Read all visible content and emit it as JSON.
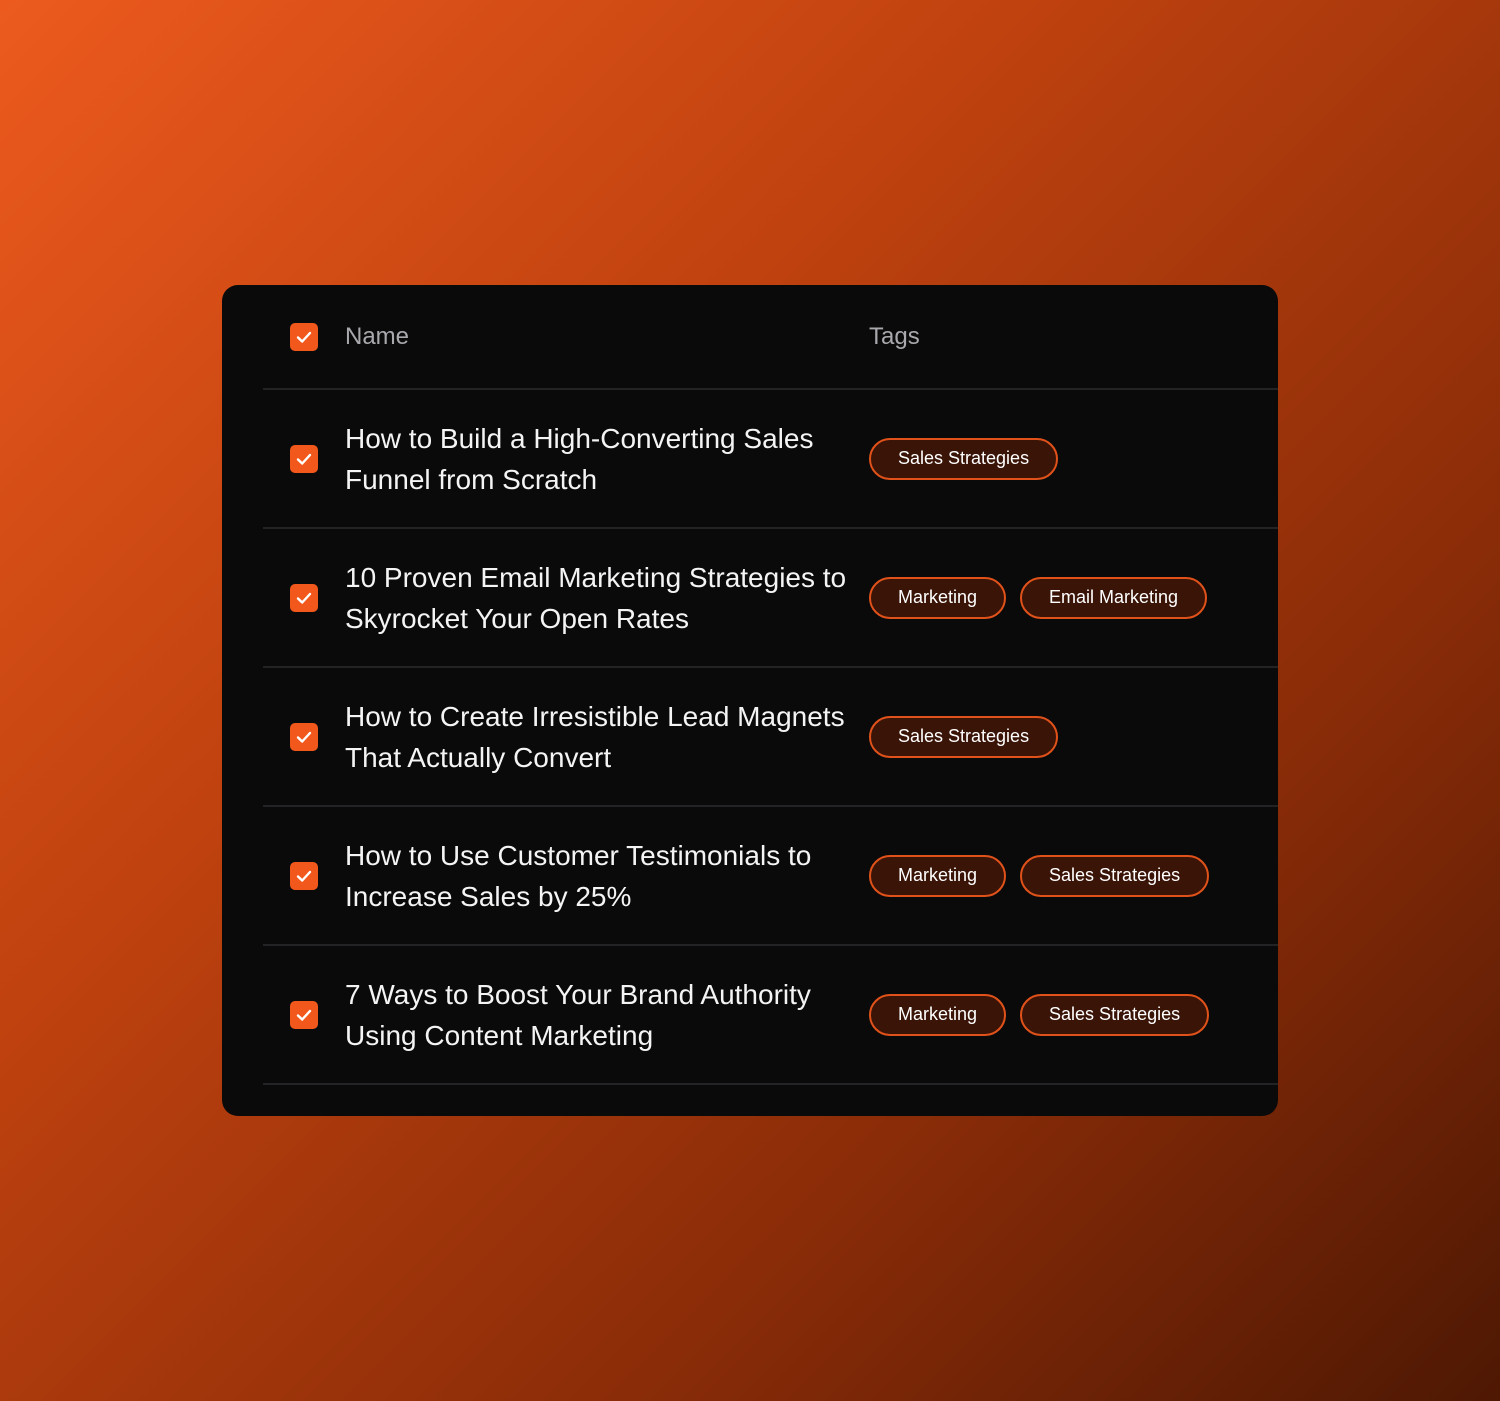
{
  "colors": {
    "accent": "#f2581b",
    "panel_bg": "#0a0a0b",
    "tag_bg": "#3a1407",
    "tag_border": "#e0521a"
  },
  "table": {
    "columns": {
      "name": "Name",
      "tags": "Tags"
    },
    "header_checked": true,
    "rows": [
      {
        "checked": true,
        "title": "How to Build a High-Converting Sales Funnel from Scratch",
        "tags": [
          "Sales Strategies"
        ]
      },
      {
        "checked": true,
        "title": "10 Proven Email Marketing Strategies to Skyrocket Your Open Rates",
        "tags": [
          "Marketing",
          "Email Marketing"
        ]
      },
      {
        "checked": true,
        "title": "How to Create Irresistible Lead Magnets That Actually Convert",
        "tags": [
          "Sales Strategies"
        ]
      },
      {
        "checked": true,
        "title": "How to Use Customer Testimonials to Increase Sales by 25%",
        "tags": [
          "Marketing",
          "Sales Strategies"
        ]
      },
      {
        "checked": true,
        "title": "7 Ways to Boost Your Brand Authority Using Content Marketing",
        "tags": [
          "Marketing",
          "Sales Strategies"
        ]
      }
    ]
  }
}
